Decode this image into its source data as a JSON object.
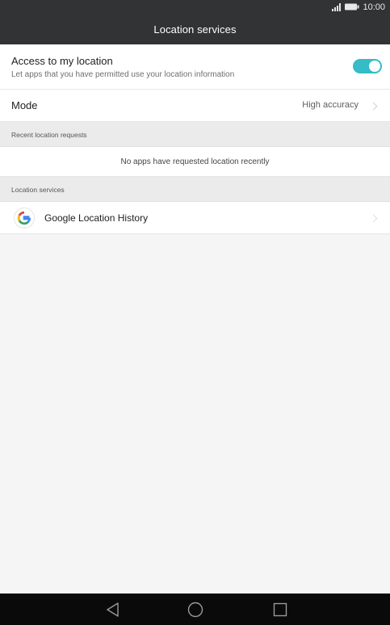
{
  "status_bar": {
    "time": "10:00",
    "icons": [
      "signal-icon",
      "battery-icon"
    ]
  },
  "app_bar": {
    "title": "Location services"
  },
  "access": {
    "title": "Access to my location",
    "subtitle": "Let apps that you have permitted use your location information",
    "enabled": true,
    "accent": "#35bcc6"
  },
  "mode": {
    "label": "Mode",
    "value": "High accuracy"
  },
  "recent_requests": {
    "header": "Recent location requests",
    "empty_text": "No apps have requested location recently"
  },
  "location_services": {
    "header": "Location services",
    "items": [
      {
        "label": "Google Location History",
        "icon": "google-icon"
      }
    ]
  },
  "nav_bar": {
    "buttons": [
      "back-icon",
      "home-icon",
      "recent-apps-icon"
    ]
  }
}
